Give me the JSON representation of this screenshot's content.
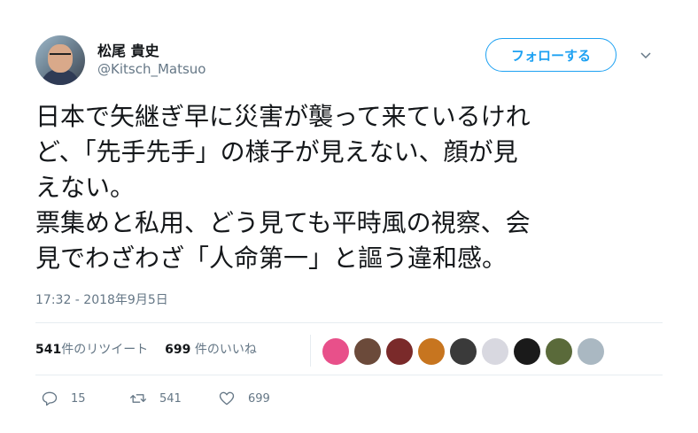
{
  "user": {
    "name": "松尾 貴史",
    "handle": "@Kitsch_Matsuo"
  },
  "follow_label": "フォローする",
  "tweet_lines": [
    "日本で矢継ぎ早に災害が襲って来ているけれ",
    "ど、「先手先手」の様子が見えない、顔が見",
    "えない。",
    "票集めと私用、どう見ても平時風の視察、会",
    "見でわざわざ「人命第一」と謳う違和感。"
  ],
  "timestamp": "17:32 - 2018年9月5日",
  "stats": {
    "retweet_count": "541",
    "retweet_label": "件のリツイート",
    "like_count": "699",
    "like_label": "件のいいね"
  },
  "actions": {
    "reply_count": "15",
    "retweet_count": "541",
    "like_count": "699"
  },
  "colors": {
    "accent": "#1da1f2",
    "muted": "#657786",
    "text": "#14171a",
    "divider": "#e6ecf0"
  },
  "liker_colors": [
    "#e8508a",
    "#6b4a3a",
    "#7a2a2a",
    "#c7751f",
    "#3a3a3a",
    "#d8d8e0",
    "#1a1a1a",
    "#5a6a3a",
    "#aab8c2"
  ]
}
